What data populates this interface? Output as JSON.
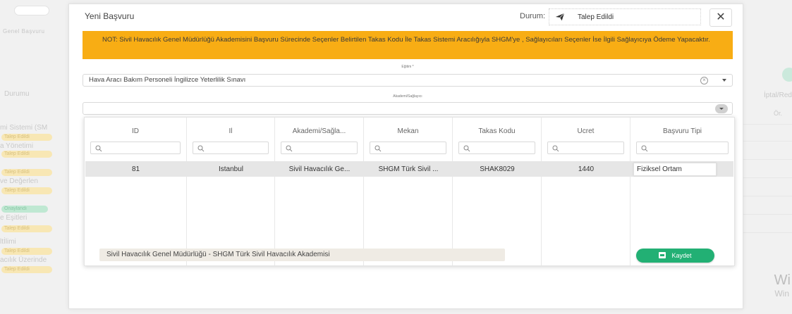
{
  "background": {
    "tabs": "Genel   Başvuru",
    "durum": "Durumu",
    "rows": [
      "mi Sistemi (SM",
      "a Yönetimi",
      "ve Değerlen",
      "e Eşitleri",
      "ltİlimi",
      "acılık Üzerinde"
    ],
    "badges": [
      "Talep Edildi",
      "Talep Edildi",
      "Talep Edildi",
      "Talep Edildi",
      "Onaylandı",
      "Talep Edildi",
      "Talep Edildi",
      "Talep Edildi"
    ],
    "right_label": "İptal/Red",
    "right_small": "Ör.",
    "watermark_1": "Wi",
    "watermark_2": "Win"
  },
  "modal": {
    "title": "Yeni Başvuru",
    "status_label": "Durum:",
    "status_value": "Talep Edildi",
    "close_symbol": "✕",
    "note": "NOT: Sivil Havacılık Genel Müdürlüğü Akademisini Başvuru Sürecinde Seçenler Belirtilen Takas Kodu İle Takas Sistemi Aracılığıyla SHGM'ye , Sağlayıcıları Seçenler İse İlgili Sağlayıcıya Ödeme Yapacaktır.",
    "egitim_label": "Eğitim *",
    "egitim_value": "Hava Aracı Bakım Personeli İngilizce Yeterlilik Sınavı",
    "akademi_label": "Akademi/Sağlayıcı",
    "akademi_value": ""
  },
  "grid": {
    "columns": [
      "ID",
      "Il",
      "Akademi/Sağla...",
      "Mekan",
      "Takas Kodu",
      "Ucret",
      "Başvuru Tipi"
    ],
    "rows": [
      {
        "id": "81",
        "il": "İstanbul",
        "akademi": "Sivil Havacılık Ge...",
        "mekan": "SHGM Türk Sivil ...",
        "takas": "SHAK8029",
        "ucret": "1440",
        "tip": "Fiziksel Ortam"
      }
    ]
  },
  "selection_text": "Sivil Havacılık Genel Müdürlüğü - SHGM Türk Sivil Havacılık Akademisi",
  "save_label": "Kaydet",
  "colors": {
    "note_bg": "#f8ad14",
    "save_bg": "#22b074"
  }
}
